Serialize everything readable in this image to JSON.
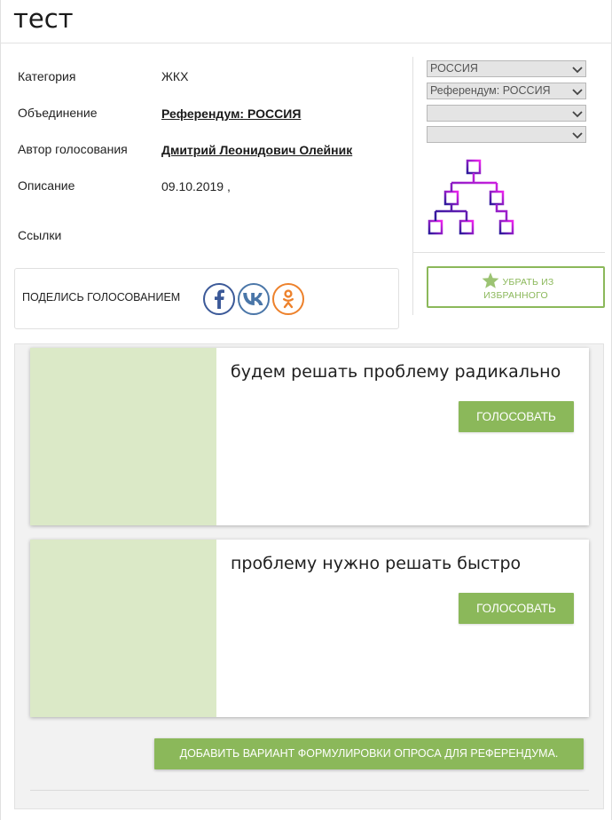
{
  "page": {
    "title": "тест"
  },
  "info": {
    "category_label": "Категория",
    "category_value": "ЖКХ",
    "union_label": "Объединение",
    "union_value": "Референдум: РОССИЯ",
    "author_label": "Автор голосования",
    "author_value": "Дмитрий Леонидович Олейник",
    "description_label": "Описание",
    "description_value": "09.10.2019 ,",
    "links_label": "Ссылки"
  },
  "share": {
    "label": "ПОДЕЛИСЬ ГОЛОСОВАНИЕМ",
    "networks": [
      {
        "name": "facebook",
        "icon": "facebook-icon",
        "color": "#3b5998"
      },
      {
        "name": "vk",
        "icon": "vk-icon",
        "color": "#4a76a8"
      },
      {
        "name": "odnoklassniki",
        "icon": "odnoklassniki-icon",
        "color": "#ed812b"
      }
    ]
  },
  "filters": {
    "select1": "РОССИЯ",
    "select2": "Референдум: РОССИЯ",
    "select3": "",
    "select4": ""
  },
  "favorite": {
    "line1": "УБРАТЬ ИЗ",
    "line2": "ИЗБРАННОГО",
    "icon": "star-icon"
  },
  "options": [
    {
      "text": "будем решать проблему радикально",
      "vote_label": "ГОЛОСОВАТЬ"
    },
    {
      "text": "проблему нужно решать быстро",
      "vote_label": "ГОЛОСОВАТЬ"
    }
  ],
  "add_variant_label": "ДОБАВИТЬ ВАРИАНТ ФОРМУЛИРОВКИ ОПРОСА ДЛЯ РЕФЕРЕНДУМА.",
  "colors": {
    "accent_green": "#8bb85a",
    "option_image_bg": "#dbe9c7",
    "tree_gradient_start": "#2a1a9a",
    "tree_gradient_end": "#ee22ee"
  }
}
